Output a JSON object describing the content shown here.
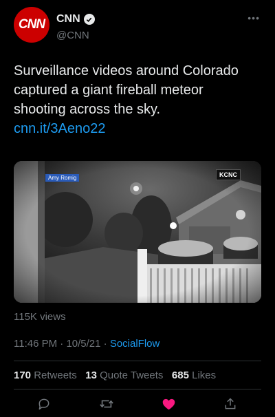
{
  "author": {
    "display_name": "CNN",
    "handle": "@CNN",
    "avatar_text": "CNN",
    "verified": true,
    "avatar_color": "#cc0000"
  },
  "menu": {
    "more_label": "•••"
  },
  "tweet": {
    "text": "Surveillance videos around Colorado captured a giant fireball meteor shooting across the sky. ",
    "link": "cnn.it/3Aeno22"
  },
  "media": {
    "caption_tag": "Amy Romig",
    "station_tag": "KCNC"
  },
  "views": "115K views",
  "meta": {
    "time": "11:46 PM",
    "date": "10/5/21",
    "source": "SocialFlow",
    "sep": " · "
  },
  "stats": {
    "retweets_count": "170",
    "retweets_label": "Retweets",
    "quotes_count": "13",
    "quotes_label": "Quote Tweets",
    "likes_count": "685",
    "likes_label": "Likes"
  },
  "actions": {
    "reply_icon": "reply-icon",
    "retweet_icon": "retweet-icon",
    "like_icon": "heart-icon",
    "share_icon": "share-icon",
    "like_color": "#f91880"
  },
  "colors": {
    "accent": "#1d9bf0",
    "muted": "#71767b",
    "text": "#e7e9ea",
    "background": "#000000"
  }
}
